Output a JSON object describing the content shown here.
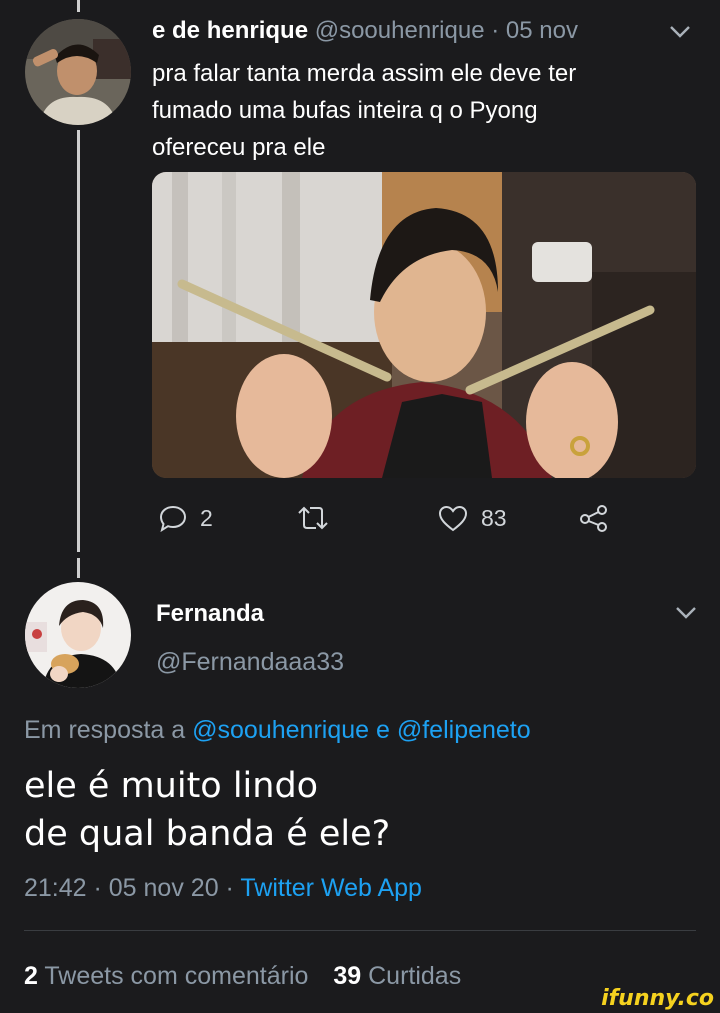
{
  "tweet1": {
    "display_name": "e de henrique",
    "handle": "@soouhenrique",
    "date": "· 05 nov",
    "lines": [
      "pra falar tanta merda assim ele deve ter",
      "fumado uma bufas inteira q o Pyong",
      "ofereceu pra ele"
    ],
    "actions": {
      "reply_count": "2",
      "like_count": "83"
    }
  },
  "tweet2": {
    "display_name": "Fernanda",
    "handle": "@Fernandaaa33",
    "reply_prefix": "Em resposta a",
    "reply_user1": "@soouhenrique",
    "reply_and": "e",
    "reply_user2": "@felipeneto",
    "text_line1": "ele é muito lindo",
    "text_line2": "de qual banda é ele?",
    "time": "21:42 · 05 nov 20 ·",
    "source": "Twitter Web App"
  },
  "stats": {
    "tweets_count": "2",
    "tweets_label": "Tweets com comentário",
    "likes_count": "39",
    "likes_label": "Curtidas"
  },
  "watermark": "ifunny.co",
  "colors": {
    "background": "#1b1b1d",
    "link": "#1da1f2",
    "muted": "#8b98a5",
    "watermark": "#f5d21f"
  }
}
